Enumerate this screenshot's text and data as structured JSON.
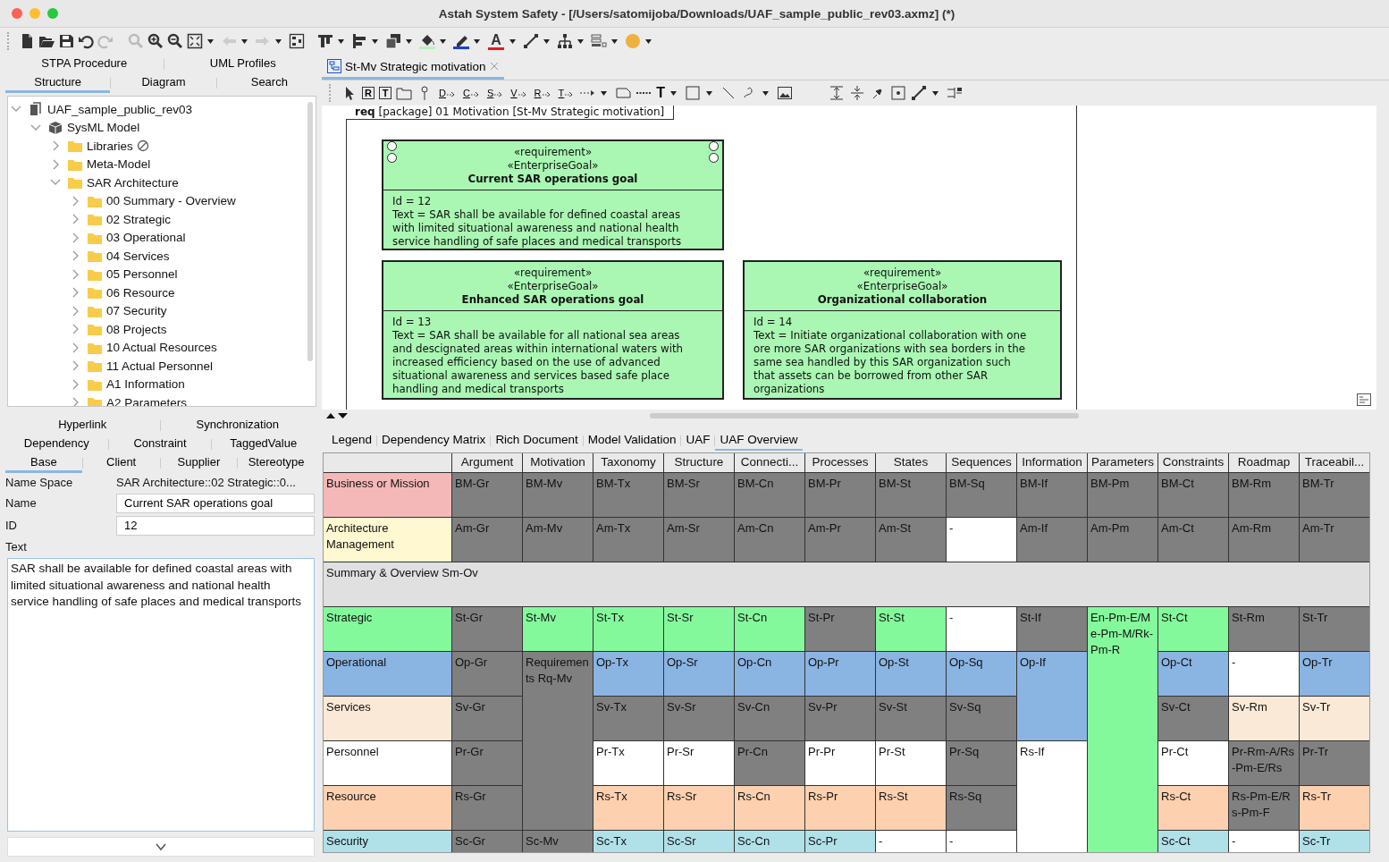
{
  "window": {
    "title": "Astah System Safety - [/Users/satomijoba/Downloads/UAF_sample_public_rev03.axmz] (*)"
  },
  "toolbar": {
    "font_color_glyph": "A"
  },
  "left_tabs": [
    [
      {
        "label": "STPA Procedure",
        "selected": false
      },
      {
        "label": "UML Profiles",
        "selected": false
      }
    ],
    [
      {
        "label": "Structure",
        "selected": true
      },
      {
        "label": "Diagram",
        "selected": false
      },
      {
        "label": "Search",
        "selected": false
      }
    ]
  ],
  "tree": [
    {
      "label": "UAF_sample_public_rev03",
      "kind": "project",
      "expanded": true,
      "read_only": false,
      "children": [
        {
          "label": "SysML Model",
          "kind": "model",
          "expanded": true,
          "read_only": false,
          "children": [
            {
              "label": "Libraries",
              "kind": "folder",
              "expanded": false,
              "read_only": true
            },
            {
              "label": "Meta-Model",
              "kind": "folder",
              "expanded": false,
              "read_only": false
            },
            {
              "label": "SAR Architecture",
              "kind": "folder",
              "expanded": true,
              "read_only": false,
              "children": [
                {
                  "label": "00 Summary - Overview",
                  "kind": "folder",
                  "expanded": false,
                  "read_only": false
                },
                {
                  "label": "02 Strategic",
                  "kind": "folder",
                  "expanded": false,
                  "read_only": false
                },
                {
                  "label": "03 Operational",
                  "kind": "folder",
                  "expanded": false,
                  "read_only": false
                },
                {
                  "label": "04 Services",
                  "kind": "folder",
                  "expanded": false,
                  "read_only": false
                },
                {
                  "label": "05 Personnel",
                  "kind": "folder",
                  "expanded": false,
                  "read_only": false
                },
                {
                  "label": "06 Resource",
                  "kind": "folder",
                  "expanded": false,
                  "read_only": false
                },
                {
                  "label": "07 Security",
                  "kind": "folder",
                  "expanded": false,
                  "read_only": false
                },
                {
                  "label": "08 Projects",
                  "kind": "folder",
                  "expanded": false,
                  "read_only": false
                },
                {
                  "label": "10 Actual Resources",
                  "kind": "folder",
                  "expanded": false,
                  "read_only": false
                },
                {
                  "label": "11 Actual Personnel",
                  "kind": "folder",
                  "expanded": false,
                  "read_only": false
                },
                {
                  "label": "A1 Information",
                  "kind": "folder",
                  "expanded": false,
                  "read_only": false
                },
                {
                  "label": "A2 Parameters",
                  "kind": "folder",
                  "expanded": false,
                  "read_only": false
                }
              ]
            }
          ]
        }
      ]
    }
  ],
  "property_tabs": [
    [
      {
        "label": "Hyperlink",
        "selected": false
      },
      {
        "label": "Synchronization",
        "selected": false
      }
    ],
    [
      {
        "label": "Dependency",
        "selected": false
      },
      {
        "label": "Constraint",
        "selected": false
      },
      {
        "label": "TaggedValue",
        "selected": false
      }
    ],
    [
      {
        "label": "Base",
        "selected": true
      },
      {
        "label": "Client",
        "selected": false
      },
      {
        "label": "Supplier",
        "selected": false
      },
      {
        "label": "Stereotype",
        "selected": false
      }
    ]
  ],
  "properties": {
    "name_space": {
      "label": "Name Space",
      "value": "SAR Architecture::02 Strategic::0..."
    },
    "name": {
      "label": "Name",
      "value": "Current SAR operations goal"
    },
    "id": {
      "label": "ID",
      "value": "12"
    },
    "text": {
      "label": "Text",
      "value": "SAR shall be available for defined coastal areas with limited situational awareness and national health service handling of safe places and medical transports"
    }
  },
  "diagram_tab": {
    "label": "St-Mv Strategic motivation",
    "selected": true
  },
  "diagram_toolbar": {
    "glyphs": [
      "R",
      "T",
      "D",
      "C",
      "S",
      "V",
      "R",
      "T",
      "T"
    ]
  },
  "diagram": {
    "frame_label": "**req** [package] 01 Motivation [St-Mv Strategic motivation]",
    "requirements": [
      {
        "stereotypes": [
          "«requirement»",
          "«EnterpriseGoal»"
        ],
        "name": "Current SAR operations goal",
        "selected": true,
        "lines": [
          "Id = 12",
          "Text = SAR shall be available for defined coastal areas",
          "with limited situational awareness and national health",
          "service handling of safe places and medical transports"
        ]
      },
      {
        "stereotypes": [
          "«requirement»",
          "«EnterpriseGoal»"
        ],
        "name": "Enhanced SAR operations goal",
        "selected": false,
        "lines": [
          "Id = 13",
          "Text = SAR shall be available for all national sea areas",
          "and descignated areas within international waters with",
          "increased efficiency based on the use of advanced",
          "situational awareness and services based safe place",
          "handling and medical transports"
        ]
      },
      {
        "stereotypes": [
          "«requirement»",
          "«EnterpriseGoal»"
        ],
        "name": "Organizational collaboration",
        "selected": false,
        "lines": [
          "Id = 14",
          "Text = Initiate organizational collaboration with one",
          "ore more SAR organizations with sea borders in the",
          "same sea handled by this SAR organization such",
          "that assets can be borrowed from other SAR",
          "organizations"
        ]
      }
    ]
  },
  "bottom_tabs": [
    {
      "label": "Legend",
      "selected": false
    },
    {
      "label": "Dependency Matrix",
      "selected": false
    },
    {
      "label": "Rich Document",
      "selected": false
    },
    {
      "label": "Model Validation",
      "selected": false
    },
    {
      "label": "UAF",
      "selected": false
    },
    {
      "label": "UAF Overview",
      "selected": true
    }
  ],
  "table": {
    "columns": [
      "Argument",
      "Motivation",
      "Taxonomy",
      "Structure",
      "Connecti...",
      "Processes",
      "States",
      "Sequences",
      "Information",
      "Parameters",
      "Constraints",
      "Roadmap",
      "Traceabil..."
    ],
    "rows": [
      {
        "kind": "row",
        "label": "Business or Mission",
        "color": "#f5b8b8",
        "cells": [
          {
            "text": "BM-Gr",
            "color": "#808080"
          },
          {
            "text": "BM-Mv",
            "color": "#808080"
          },
          {
            "text": "BM-Tx",
            "color": "#808080"
          },
          {
            "text": "BM-Sr",
            "color": "#808080"
          },
          {
            "text": "BM-Cn",
            "color": "#808080"
          },
          {
            "text": "BM-Pr",
            "color": "#808080"
          },
          {
            "text": "BM-St",
            "color": "#808080"
          },
          {
            "text": "BM-Sq",
            "color": "#808080"
          },
          {
            "text": "BM-If",
            "color": "#808080"
          },
          {
            "text": "BM-Pm",
            "color": "#808080"
          },
          {
            "text": "BM-Ct",
            "color": "#808080"
          },
          {
            "text": "BM-Rm",
            "color": "#808080"
          },
          {
            "text": "BM-Tr",
            "color": "#808080"
          }
        ]
      },
      {
        "kind": "row",
        "label": "Architecture Management",
        "color": "#fff8d0",
        "cells": [
          {
            "text": "Am-Gr",
            "color": "#808080"
          },
          {
            "text": "Am-Mv",
            "color": "#808080"
          },
          {
            "text": "Am-Tx",
            "color": "#808080"
          },
          {
            "text": "Am-Sr",
            "color": "#808080"
          },
          {
            "text": "Am-Cn",
            "color": "#808080"
          },
          {
            "text": "Am-Pr",
            "color": "#808080"
          },
          {
            "text": "Am-St",
            "color": "#808080"
          },
          {
            "text": "-",
            "color": "#ffffff"
          },
          {
            "text": "Am-If",
            "color": "#808080"
          },
          {
            "text": "Am-Pm",
            "color": "#808080"
          },
          {
            "text": "Am-Ct",
            "color": "#808080"
          },
          {
            "text": "Am-Rm",
            "color": "#808080"
          },
          {
            "text": "Am-Tr",
            "color": "#808080"
          }
        ]
      },
      {
        "kind": "section",
        "label": "Summary & Overview Sm-Ov",
        "color": "#e0e0e0"
      },
      {
        "kind": "row",
        "label": "Strategic",
        "color": "#84f99c",
        "cells": [
          {
            "text": "St-Gr",
            "color": "#808080"
          },
          {
            "text": "St-Mv",
            "color": "#84f99c"
          },
          {
            "text": "St-Tx",
            "color": "#84f99c"
          },
          {
            "text": "St-Sr",
            "color": "#84f99c"
          },
          {
            "text": "St-Cn",
            "color": "#84f99c"
          },
          {
            "text": "St-Pr",
            "color": "#808080"
          },
          {
            "text": "St-St",
            "color": "#84f99c"
          },
          {
            "text": "-",
            "color": "#ffffff"
          },
          {
            "text": "St-If",
            "color": "#808080"
          },
          {
            "text": "En-Pm-E/Me-Pm-M/Rk-Pm-R",
            "color": "#84f99c"
          },
          {
            "text": "St-Ct",
            "color": "#84f99c"
          },
          {
            "text": "St-Rm",
            "color": "#808080"
          },
          {
            "text": "St-Tr",
            "color": "#808080"
          }
        ]
      },
      {
        "kind": "row",
        "label": "Operational",
        "color": "#8ab4e2",
        "cells": [
          {
            "text": "Op-Gr",
            "color": "#808080"
          },
          {
            "text": "Requirements Rq-Mv",
            "color": "#808080"
          },
          {
            "text": "Op-Tx",
            "color": "#8ab4e2"
          },
          {
            "text": "Op-Sr",
            "color": "#8ab4e2"
          },
          {
            "text": "Op-Cn",
            "color": "#8ab4e2"
          },
          {
            "text": "Op-Pr",
            "color": "#8ab4e2"
          },
          {
            "text": "Op-St",
            "color": "#8ab4e2"
          },
          {
            "text": "Op-Sq",
            "color": "#8ab4e2"
          },
          {
            "text": "Op-If",
            "color": "#8ab4e2"
          },
          {
            "kind": "merged"
          },
          {
            "text": "Op-Ct",
            "color": "#8ab4e2"
          },
          {
            "text": "-",
            "color": "#ffffff"
          },
          {
            "text": "Op-Tr",
            "color": "#8ab4e2"
          }
        ]
      },
      {
        "kind": "row",
        "label": "Services",
        "color": "#fbe9d8",
        "cells": [
          {
            "text": "Sv-Gr",
            "color": "#808080"
          },
          {
            "kind": "merged"
          },
          {
            "text": "Sv-Tx",
            "color": "#808080"
          },
          {
            "text": "Sv-Sr",
            "color": "#808080"
          },
          {
            "text": "Sv-Cn",
            "color": "#808080"
          },
          {
            "text": "Sv-Pr",
            "color": "#808080"
          },
          {
            "text": "Sv-St",
            "color": "#808080"
          },
          {
            "text": "Sv-Sq",
            "color": "#808080"
          },
          {
            "kind": "merged"
          },
          {
            "kind": "merged"
          },
          {
            "text": "Sv-Ct",
            "color": "#808080"
          },
          {
            "text": "Sv-Rm",
            "color": "#fbe9d8"
          },
          {
            "text": "Sv-Tr",
            "color": "#fbe9d8"
          }
        ]
      },
      {
        "kind": "row",
        "label": "Personnel",
        "color": "#ffffff",
        "cells": [
          {
            "text": "Pr-Gr",
            "color": "#808080"
          },
          {
            "kind": "merged"
          },
          {
            "text": "Pr-Tx",
            "color": "#ffffff"
          },
          {
            "text": "Pr-Sr",
            "color": "#ffffff"
          },
          {
            "text": "Pr-Cn",
            "color": "#808080"
          },
          {
            "text": "Pr-Pr",
            "color": "#ffffff"
          },
          {
            "text": "Pr-St",
            "color": "#ffffff"
          },
          {
            "text": "Pr-Sq",
            "color": "#808080"
          },
          {
            "text": "Rs-If",
            "color": "#ffffff"
          },
          {
            "kind": "merged"
          },
          {
            "text": "Pr-Ct",
            "color": "#ffffff"
          },
          {
            "text": "Pr-Rm-A/Rs-Pm-E/Rs",
            "color": "#808080"
          },
          {
            "text": "Pr-Tr",
            "color": "#808080"
          }
        ]
      },
      {
        "kind": "row",
        "label": "Resource",
        "color": "#fdd1b0",
        "cells": [
          {
            "text": "Rs-Gr",
            "color": "#808080"
          },
          {
            "kind": "merged"
          },
          {
            "text": "Rs-Tx",
            "color": "#fdd1b0"
          },
          {
            "text": "Rs-Sr",
            "color": "#fdd1b0"
          },
          {
            "text": "Rs-Cn",
            "color": "#fdd1b0"
          },
          {
            "text": "Rs-Pr",
            "color": "#fdd1b0"
          },
          {
            "text": "Rs-St",
            "color": "#fdd1b0"
          },
          {
            "text": "Rs-Sq",
            "color": "#808080"
          },
          {
            "kind": "merged"
          },
          {
            "kind": "merged"
          },
          {
            "text": "Rs-Ct",
            "color": "#fdd1b0"
          },
          {
            "text": "Rs-Pm-E/Rs-Pm-F",
            "color": "#808080"
          },
          {
            "text": "Rs-Tr",
            "color": "#fdd1b0"
          }
        ]
      },
      {
        "kind": "row",
        "label": "Security",
        "color": "#b0e0e8",
        "cells": [
          {
            "text": "Sc-Gr",
            "color": "#808080"
          },
          {
            "text": "Sc-Mv",
            "color": "#808080"
          },
          {
            "text": "Sc-Tx",
            "color": "#b0e0e8"
          },
          {
            "text": "Sc-Sr",
            "color": "#b0e0e8"
          },
          {
            "text": "Sc-Cn",
            "color": "#b0e0e8"
          },
          {
            "text": "Sc-Pr",
            "color": "#b0e0e8"
          },
          {
            "text": "-",
            "color": "#ffffff"
          },
          {
            "text": "-",
            "color": "#ffffff"
          },
          {
            "kind": "merged"
          },
          {
            "kind": "merged"
          },
          {
            "text": "Sc-Ct",
            "color": "#b0e0e8"
          },
          {
            "text": "-",
            "color": "#ffffff"
          },
          {
            "text": "Sc-Tr",
            "color": "#b0e0e8"
          }
        ]
      }
    ]
  }
}
